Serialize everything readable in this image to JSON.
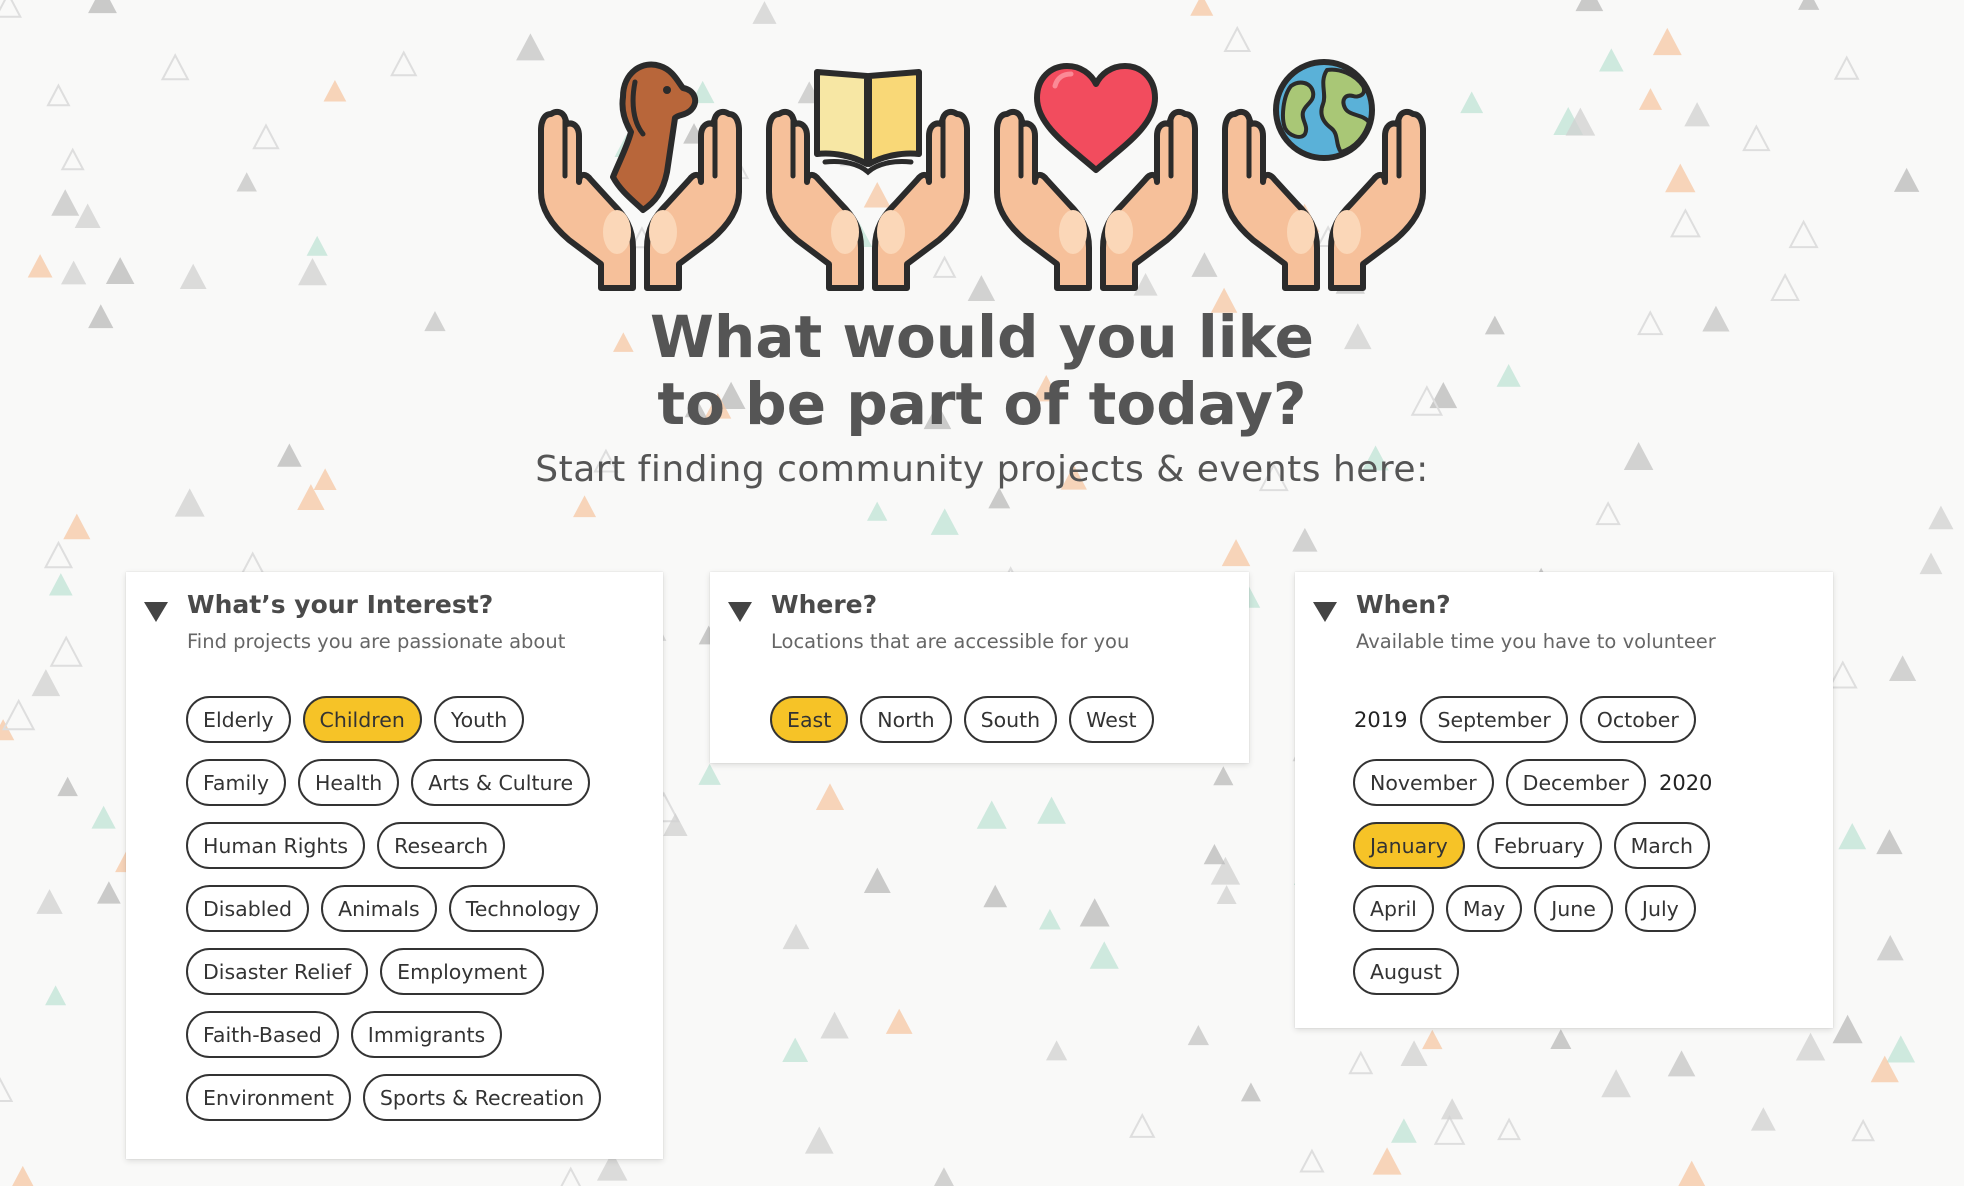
{
  "hero": {
    "title_line1": "What would you like",
    "title_line2": "to be part of today?",
    "subtitle": "Start finding community projects & events here:"
  },
  "hero_icons": [
    {
      "name": "hands-dog-icon"
    },
    {
      "name": "hands-book-icon"
    },
    {
      "name": "hands-heart-icon"
    },
    {
      "name": "hands-globe-icon"
    }
  ],
  "colors": {
    "accent": "#f6c327",
    "chip_border": "#333333",
    "heading": "#555555",
    "hand": "#f6c09a",
    "hand_outline": "#2b2b2b",
    "heart": "#f24c5e",
    "dog": "#b8663a",
    "book": "#f7e7a4",
    "globe_sea": "#5ab1d8",
    "globe_land": "#a9c776"
  },
  "panels": {
    "interest": {
      "title": "What’s your Interest?",
      "subtitle": "Find projects you are passionate about",
      "chips": [
        {
          "label": "Elderly",
          "selected": false
        },
        {
          "label": "Children",
          "selected": true
        },
        {
          "label": "Youth",
          "selected": false
        },
        {
          "label": "Family",
          "selected": false
        },
        {
          "label": "Health",
          "selected": false
        },
        {
          "label": "Arts & Culture",
          "selected": false
        },
        {
          "label": "Human Rights",
          "selected": false
        },
        {
          "label": "Research",
          "selected": false
        },
        {
          "label": "Disabled",
          "selected": false
        },
        {
          "label": "Animals",
          "selected": false
        },
        {
          "label": "Technology",
          "selected": false
        },
        {
          "label": "Disaster Relief",
          "selected": false
        },
        {
          "label": "Employment",
          "selected": false
        },
        {
          "label": "Faith-Based",
          "selected": false
        },
        {
          "label": "Immigrants",
          "selected": false
        },
        {
          "label": "Environment",
          "selected": false
        },
        {
          "label": "Sports & Recreation",
          "selected": false
        }
      ]
    },
    "where": {
      "title": "Where?",
      "subtitle": "Locations that are accessible for you",
      "chips": [
        {
          "label": "East",
          "selected": true
        },
        {
          "label": "North",
          "selected": false
        },
        {
          "label": "South",
          "selected": false
        },
        {
          "label": "West",
          "selected": false
        }
      ]
    },
    "when": {
      "title": "When?",
      "subtitle": "Available time you have to volunteer",
      "items": [
        {
          "type": "year",
          "label": "2019"
        },
        {
          "type": "chip",
          "label": "September",
          "selected": false
        },
        {
          "type": "chip",
          "label": "October",
          "selected": false
        },
        {
          "type": "chip",
          "label": "November",
          "selected": false
        },
        {
          "type": "chip",
          "label": "December",
          "selected": false
        },
        {
          "type": "year",
          "label": "2020"
        },
        {
          "type": "chip",
          "label": "January",
          "selected": true
        },
        {
          "type": "chip",
          "label": "February",
          "selected": false
        },
        {
          "type": "chip",
          "label": "March",
          "selected": false
        },
        {
          "type": "chip",
          "label": "April",
          "selected": false
        },
        {
          "type": "chip",
          "label": "May",
          "selected": false
        },
        {
          "type": "chip",
          "label": "June",
          "selected": false
        },
        {
          "type": "chip",
          "label": "July",
          "selected": false
        },
        {
          "type": "chip",
          "label": "August",
          "selected": false
        }
      ]
    }
  }
}
